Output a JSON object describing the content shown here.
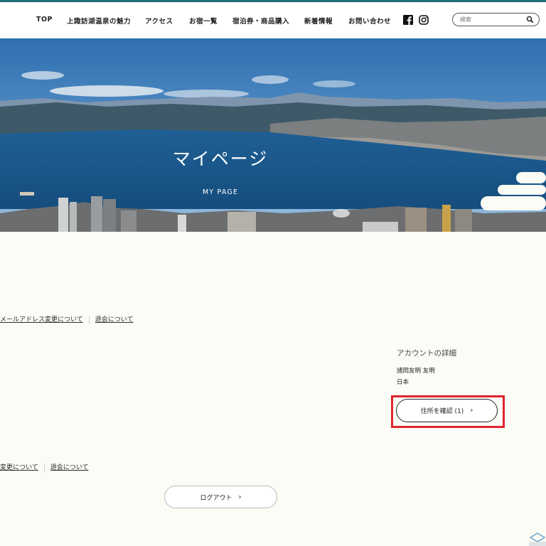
{
  "nav": {
    "items": [
      "TOP",
      "上諏訪湖温泉の魅力",
      "アクセス",
      "お宿一覧",
      "宿泊券・商品購入",
      "新着情報",
      "お問い合わせ"
    ]
  },
  "search": {
    "placeholder": "検索"
  },
  "hero": {
    "title": "マイページ",
    "subtitle": "MY PAGE"
  },
  "links_top": {
    "email_change": "メールアドレス変更について",
    "withdraw": "退会について"
  },
  "account": {
    "heading": "アカウントの詳細",
    "name": "諸岡友明 友明",
    "country": "日本",
    "address_button": "住所を確認 (1)"
  },
  "links_bottom": {
    "email_change": "変更について",
    "withdraw": "退会について"
  },
  "logout": {
    "label": "ログアウト"
  },
  "colors": {
    "accent_line": "#1f6e78",
    "highlight": "#e0252f",
    "background": "#fcfcf6"
  }
}
